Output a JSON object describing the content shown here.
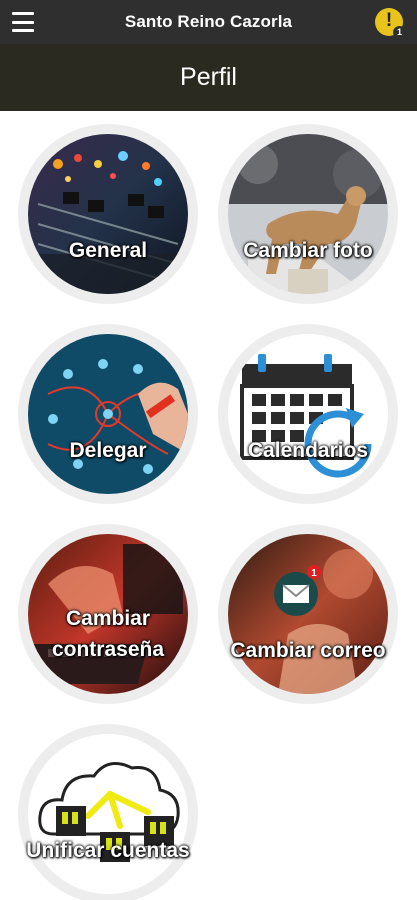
{
  "header": {
    "title": "Santo Reino Cazorla",
    "menu_icon": "hamburger-menu-icon",
    "alert_icon": "exclamation-icon",
    "alert_symbol": "!",
    "alert_count": "1"
  },
  "section": {
    "title": "Perfil"
  },
  "tiles": [
    {
      "id": "general",
      "label": "General",
      "icon": "mixing-console-image"
    },
    {
      "id": "change-photo",
      "label": "Cambiar foto",
      "icon": "puma-image"
    },
    {
      "id": "delegate",
      "label": "Delegar",
      "icon": "network-people-image"
    },
    {
      "id": "calendars",
      "label": "Calendarios",
      "icon": "calendar-refresh-image"
    },
    {
      "id": "change-password",
      "label": "Cambiar contraseña",
      "label_line1": "Cambiar",
      "label_line2": "contraseña",
      "icon": "keyboard-image"
    },
    {
      "id": "change-email",
      "label": "Cambiar correo",
      "icon": "email-notification-image",
      "badge": "1"
    },
    {
      "id": "merge-accounts",
      "label": "Unificar cuentas",
      "icon": "cloud-accounts-image"
    }
  ],
  "colors": {
    "appbar": "#2f2f2f",
    "section_bar": "#2a2a20",
    "tile_ring": "#ededed",
    "alert": "#e7c31c"
  }
}
